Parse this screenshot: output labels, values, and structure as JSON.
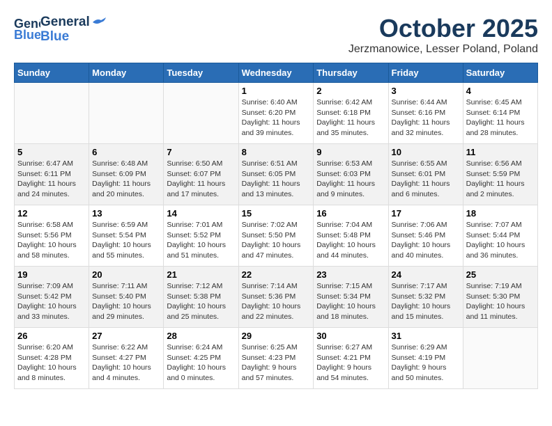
{
  "header": {
    "logo_general": "General",
    "logo_blue": "Blue",
    "month_title": "October 2025",
    "location": "Jerzmanowice, Lesser Poland, Poland"
  },
  "days_of_week": [
    "Sunday",
    "Monday",
    "Tuesday",
    "Wednesday",
    "Thursday",
    "Friday",
    "Saturday"
  ],
  "weeks": [
    {
      "days": [
        {
          "number": "",
          "info": ""
        },
        {
          "number": "",
          "info": ""
        },
        {
          "number": "",
          "info": ""
        },
        {
          "number": "1",
          "info": "Sunrise: 6:40 AM\nSunset: 6:20 PM\nDaylight: 11 hours\nand 39 minutes."
        },
        {
          "number": "2",
          "info": "Sunrise: 6:42 AM\nSunset: 6:18 PM\nDaylight: 11 hours\nand 35 minutes."
        },
        {
          "number": "3",
          "info": "Sunrise: 6:44 AM\nSunset: 6:16 PM\nDaylight: 11 hours\nand 32 minutes."
        },
        {
          "number": "4",
          "info": "Sunrise: 6:45 AM\nSunset: 6:14 PM\nDaylight: 11 hours\nand 28 minutes."
        }
      ]
    },
    {
      "days": [
        {
          "number": "5",
          "info": "Sunrise: 6:47 AM\nSunset: 6:11 PM\nDaylight: 11 hours\nand 24 minutes."
        },
        {
          "number": "6",
          "info": "Sunrise: 6:48 AM\nSunset: 6:09 PM\nDaylight: 11 hours\nand 20 minutes."
        },
        {
          "number": "7",
          "info": "Sunrise: 6:50 AM\nSunset: 6:07 PM\nDaylight: 11 hours\nand 17 minutes."
        },
        {
          "number": "8",
          "info": "Sunrise: 6:51 AM\nSunset: 6:05 PM\nDaylight: 11 hours\nand 13 minutes."
        },
        {
          "number": "9",
          "info": "Sunrise: 6:53 AM\nSunset: 6:03 PM\nDaylight: 11 hours\nand 9 minutes."
        },
        {
          "number": "10",
          "info": "Sunrise: 6:55 AM\nSunset: 6:01 PM\nDaylight: 11 hours\nand 6 minutes."
        },
        {
          "number": "11",
          "info": "Sunrise: 6:56 AM\nSunset: 5:59 PM\nDaylight: 11 hours\nand 2 minutes."
        }
      ]
    },
    {
      "days": [
        {
          "number": "12",
          "info": "Sunrise: 6:58 AM\nSunset: 5:56 PM\nDaylight: 10 hours\nand 58 minutes."
        },
        {
          "number": "13",
          "info": "Sunrise: 6:59 AM\nSunset: 5:54 PM\nDaylight: 10 hours\nand 55 minutes."
        },
        {
          "number": "14",
          "info": "Sunrise: 7:01 AM\nSunset: 5:52 PM\nDaylight: 10 hours\nand 51 minutes."
        },
        {
          "number": "15",
          "info": "Sunrise: 7:02 AM\nSunset: 5:50 PM\nDaylight: 10 hours\nand 47 minutes."
        },
        {
          "number": "16",
          "info": "Sunrise: 7:04 AM\nSunset: 5:48 PM\nDaylight: 10 hours\nand 44 minutes."
        },
        {
          "number": "17",
          "info": "Sunrise: 7:06 AM\nSunset: 5:46 PM\nDaylight: 10 hours\nand 40 minutes."
        },
        {
          "number": "18",
          "info": "Sunrise: 7:07 AM\nSunset: 5:44 PM\nDaylight: 10 hours\nand 36 minutes."
        }
      ]
    },
    {
      "days": [
        {
          "number": "19",
          "info": "Sunrise: 7:09 AM\nSunset: 5:42 PM\nDaylight: 10 hours\nand 33 minutes."
        },
        {
          "number": "20",
          "info": "Sunrise: 7:11 AM\nSunset: 5:40 PM\nDaylight: 10 hours\nand 29 minutes."
        },
        {
          "number": "21",
          "info": "Sunrise: 7:12 AM\nSunset: 5:38 PM\nDaylight: 10 hours\nand 25 minutes."
        },
        {
          "number": "22",
          "info": "Sunrise: 7:14 AM\nSunset: 5:36 PM\nDaylight: 10 hours\nand 22 minutes."
        },
        {
          "number": "23",
          "info": "Sunrise: 7:15 AM\nSunset: 5:34 PM\nDaylight: 10 hours\nand 18 minutes."
        },
        {
          "number": "24",
          "info": "Sunrise: 7:17 AM\nSunset: 5:32 PM\nDaylight: 10 hours\nand 15 minutes."
        },
        {
          "number": "25",
          "info": "Sunrise: 7:19 AM\nSunset: 5:30 PM\nDaylight: 10 hours\nand 11 minutes."
        }
      ]
    },
    {
      "days": [
        {
          "number": "26",
          "info": "Sunrise: 6:20 AM\nSunset: 4:28 PM\nDaylight: 10 hours\nand 8 minutes."
        },
        {
          "number": "27",
          "info": "Sunrise: 6:22 AM\nSunset: 4:27 PM\nDaylight: 10 hours\nand 4 minutes."
        },
        {
          "number": "28",
          "info": "Sunrise: 6:24 AM\nSunset: 4:25 PM\nDaylight: 10 hours\nand 0 minutes."
        },
        {
          "number": "29",
          "info": "Sunrise: 6:25 AM\nSunset: 4:23 PM\nDaylight: 9 hours\nand 57 minutes."
        },
        {
          "number": "30",
          "info": "Sunrise: 6:27 AM\nSunset: 4:21 PM\nDaylight: 9 hours\nand 54 minutes."
        },
        {
          "number": "31",
          "info": "Sunrise: 6:29 AM\nSunset: 4:19 PM\nDaylight: 9 hours\nand 50 minutes."
        },
        {
          "number": "",
          "info": ""
        }
      ]
    }
  ]
}
